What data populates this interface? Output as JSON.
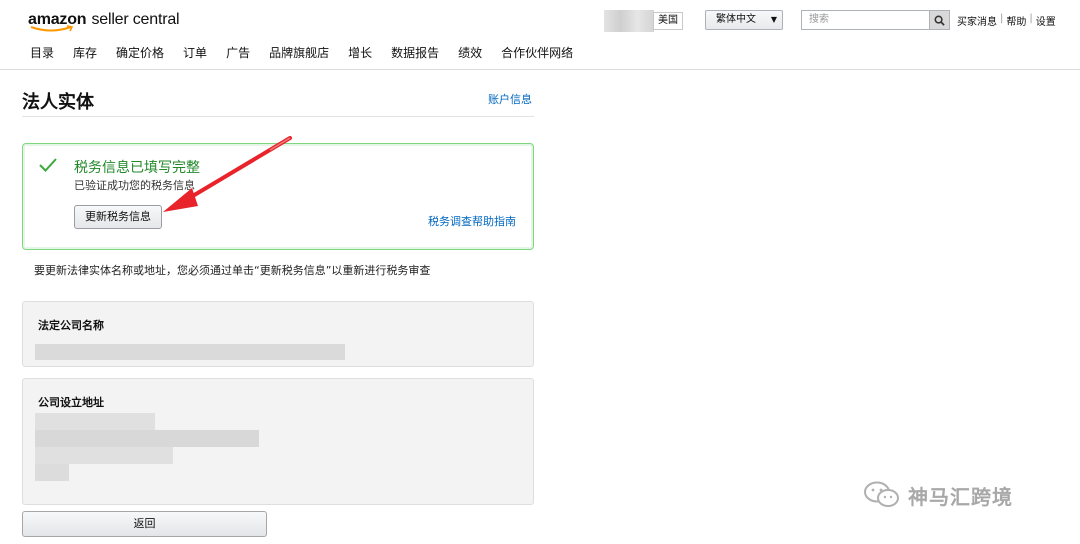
{
  "header": {
    "logo_brand": "amazon",
    "logo_product": "seller central",
    "marketplace": "美国",
    "language": "繁体中文",
    "search_placeholder": "搜索",
    "links": [
      "买家消息",
      "帮助",
      "设置"
    ],
    "link_separator": "|",
    "nav": [
      "目录",
      "库存",
      "确定价格",
      "订单",
      "广告",
      "品牌旗舰店",
      "增长",
      "数据报告",
      "绩效",
      "合作伙伴网络"
    ]
  },
  "page": {
    "title": "法人实体",
    "account_link": "账户信息",
    "success": {
      "title": "税务信息已填写完整",
      "subtitle": "已验证成功您的税务信息",
      "update_button": "更新税务信息",
      "help_link": "税务调查帮助指南"
    },
    "notice": "要更新法律实体名称或地址，您必须通过单击“更新税务信息”以重新进行税务审查",
    "legal_name_label": "法定公司名称",
    "address_label": "公司设立地址",
    "back_button": "返回"
  },
  "watermark": {
    "text": "神马汇跨境"
  },
  "colors": {
    "link": "#0066c0",
    "success_green": "#22882a",
    "success_border": "#7fd67f",
    "annotation_arrow": "#e8232a",
    "logo_smile": "#ff9900"
  },
  "icons": {
    "success": "check-icon",
    "search": "search-icon",
    "dropdown": "caret-down-icon",
    "annotation": "red-arrow-icon",
    "watermark": "wechat-icon"
  }
}
